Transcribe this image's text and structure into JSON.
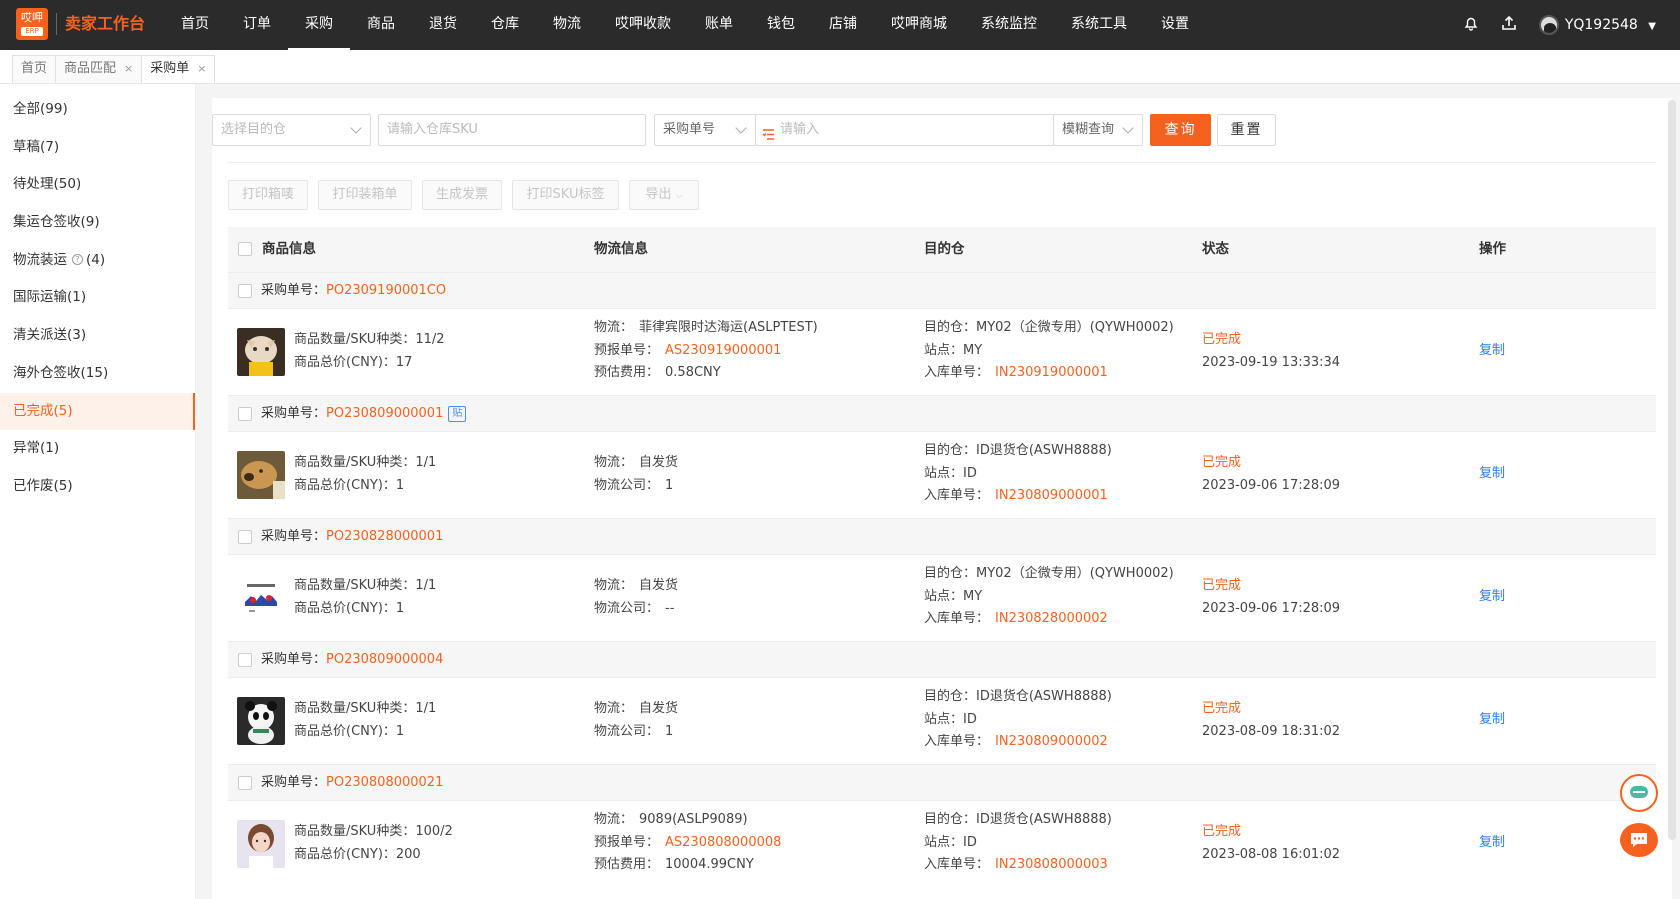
{
  "app": {
    "logo_text": "哎呷",
    "logo_sub": "ERP",
    "brand": "卖家工作台"
  },
  "nav": [
    "首页",
    "订单",
    "采购",
    "商品",
    "退货",
    "仓库",
    "物流",
    "哎呷收款",
    "账单",
    "钱包",
    "店铺",
    "哎呷商城",
    "系统监控",
    "系统工具",
    "设置"
  ],
  "nav_active": "采购",
  "user": {
    "name": "YQ192548"
  },
  "tabs": [
    {
      "label": "首页"
    },
    {
      "label": "商品匹配",
      "close": "×"
    },
    {
      "label": "采购单",
      "close": "×"
    }
  ],
  "sidebar": [
    {
      "label": "全部(99)"
    },
    {
      "label": "草稿(7)"
    },
    {
      "label": "待处理(50)"
    },
    {
      "label": "集运仓签收(9)"
    },
    {
      "label": "物流装运",
      "count": "(4)",
      "help": "?"
    },
    {
      "label": "国际运输(1)"
    },
    {
      "label": "清关派送(3)"
    },
    {
      "label": "海外仓签收(15)"
    },
    {
      "label": "已完成(5)"
    },
    {
      "label": "异常(1)"
    },
    {
      "label": "已作废(5)"
    }
  ],
  "sidebar_active": "已完成(5)",
  "filters": {
    "warehouse_placeholder": "选择目的仓",
    "sku_placeholder": "请输入仓库SKU",
    "search_type": "采购单号",
    "search_placeholder": "请输入",
    "match_mode": "模糊查询",
    "query_label": "查询",
    "reset_label": "重置"
  },
  "actions": {
    "print_mark": "打印箱唛",
    "print_packing": "打印装箱单",
    "gen_invoice": "生成发票",
    "print_sku": "打印SKU标签",
    "export": "导出"
  },
  "table": {
    "headers": {
      "product": "商品信息",
      "logistics": "物流信息",
      "dest": "目的仓",
      "status": "状态",
      "ops": "操作"
    },
    "po_label": "采购单号：",
    "qty_label": "商品数量/SKU种类：",
    "price_label": "商品总价(CNY)：",
    "rows": [
      {
        "po": "PO2309190001CO",
        "tag": "",
        "qty": "11/2",
        "price": "17",
        "log": [
          {
            "k": "物流：",
            "v": "菲律宾限时达海运(ASLPTEST)",
            "hl": false
          },
          {
            "k": "预报单号：",
            "v": "AS230919000001",
            "hl": true
          },
          {
            "k": "预估费用：",
            "v": "0.58CNY",
            "hl": false
          }
        ],
        "dest": "目的仓：MY02（企微专用）(QYWH0002)",
        "site": "站点：MY",
        "inbound_label": "入库单号：",
        "inbound": "IN230919000001",
        "status": "已完成",
        "time": "2023-09-19 13:33:34",
        "op": "复制",
        "img": "cat"
      },
      {
        "po": "PO230809000001",
        "tag": "贴",
        "qty": "1/1",
        "price": "1",
        "log": [
          {
            "k": "物流：",
            "v": "自发货",
            "hl": false
          },
          {
            "k": "物流公司：",
            "v": "1",
            "hl": false
          }
        ],
        "dest": "目的仓：ID退货仓(ASWH8888)",
        "site": "站点：ID",
        "inbound_label": "入库单号：",
        "inbound": "IN230809000001",
        "status": "已完成",
        "time": "2023-09-06 17:28:09",
        "op": "复制",
        "img": "dog"
      },
      {
        "po": "PO230828000001",
        "tag": "",
        "qty": "1/1",
        "price": "1",
        "log": [
          {
            "k": "物流：",
            "v": "自发货",
            "hl": false
          },
          {
            "k": "物流公司：",
            "v": "--",
            "hl": false
          }
        ],
        "dest": "目的仓：MY02（企微专用）(QYWH0002)",
        "site": "站点：MY",
        "inbound_label": "入库单号：",
        "inbound": "IN230828000002",
        "status": "已完成",
        "time": "2023-09-06 17:28:09",
        "op": "复制",
        "img": "card"
      },
      {
        "po": "PO230809000004",
        "tag": "",
        "qty": "1/1",
        "price": "1",
        "log": [
          {
            "k": "物流：",
            "v": "自发货",
            "hl": false
          },
          {
            "k": "物流公司：",
            "v": "1",
            "hl": false
          }
        ],
        "dest": "目的仓：ID退货仓(ASWH8888)",
        "site": "站点：ID",
        "inbound_label": "入库单号：",
        "inbound": "IN230809000002",
        "status": "已完成",
        "time": "2023-08-09 18:31:02",
        "op": "复制",
        "img": "panda"
      },
      {
        "po": "PO230808000021",
        "tag": "",
        "qty": "100/2",
        "price": "200",
        "log": [
          {
            "k": "物流：",
            "v": "9089(ASLP9089)",
            "hl": false
          },
          {
            "k": "预报单号：",
            "v": "AS230808000008",
            "hl": true
          },
          {
            "k": "预估费用：",
            "v": "10004.99CNY",
            "hl": false
          }
        ],
        "dest": "目的仓：ID退货仓(ASWH8888)",
        "site": "站点：ID",
        "inbound_label": "入库单号：",
        "inbound": "IN230808000003",
        "status": "已完成",
        "time": "2023-08-08 16:01:02",
        "op": "复制",
        "img": "girl"
      }
    ]
  },
  "colors": {
    "accent": "#f5621f",
    "link": "#2d7cf0",
    "topbar": "#2b2b2b"
  }
}
